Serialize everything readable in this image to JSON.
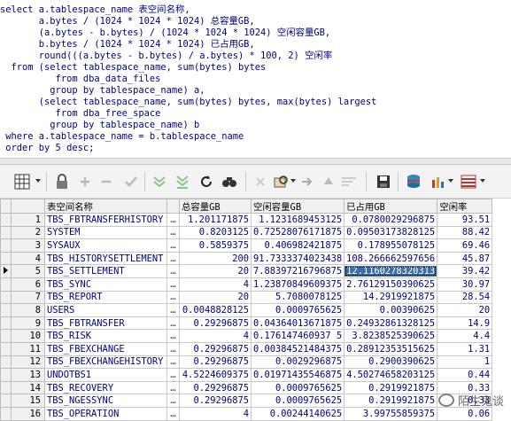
{
  "sql": {
    "lines": [
      {
        "text": "select a.tablespace_name 表空间名称,"
      },
      {
        "text": "       a.bytes / (1024 * 1024 * 1024) 总容量GB,"
      },
      {
        "text": "       (a.bytes - b.bytes) / (1024 * 1024 * 1024) 空闲容量GB,"
      },
      {
        "text": "       b.bytes / (1024 * 1024 * 1024) 已占用GB,"
      },
      {
        "text": "       round(((a.bytes - b.bytes) / a.bytes) * 100, 2) 空闲率"
      },
      {
        "text": "  from (select tablespace_name, sum(bytes) bytes"
      },
      {
        "text": "          from dba_data_files"
      },
      {
        "text": "         group by tablespace_name) a,"
      },
      {
        "text": "       (select tablespace_name, sum(bytes) bytes, max(bytes) largest"
      },
      {
        "text": "          from dba_free_space"
      },
      {
        "text": "         group by tablespace_name) b"
      },
      {
        "text": " where a.tablespace_name = b.tablespace_name"
      },
      {
        "text": " order by 5 desc;"
      }
    ]
  },
  "toolbar": {
    "icons": [
      "grid-view-icon",
      "lock-icon",
      "add-row-icon",
      "delete-row-icon",
      "post-edit-icon",
      "fetch-next-icon",
      "fetch-last-icon",
      "refresh-icon",
      "find-icon",
      "clear-icon",
      "query-by-example-icon",
      "export-icon",
      "sort-up-icon",
      "sort-down-icon",
      "chart-icon",
      "save-icon",
      "print-icon",
      "single-record-icon",
      "table-options-icon"
    ]
  },
  "grid": {
    "columns": [
      "表空间名称",
      "总容量GB",
      "空闲容量GB",
      "已占用GB",
      "空闲率"
    ],
    "rows": [
      {
        "n": "1",
        "name": "TBS_FBTRANSFERHISTORY",
        "total": "1.201171875",
        "free": "1.1231689453125",
        "used": "0.0780029296875",
        "rate": "93.51"
      },
      {
        "n": "2",
        "name": "SYSTEM",
        "total": "0.8203125",
        "free": "0.72528076171875",
        "used": "0.09503173828125",
        "rate": "88.42"
      },
      {
        "n": "3",
        "name": "SYSAUX",
        "total": "0.5859375",
        "free": "0.406982421875",
        "used": "0.178955078125",
        "rate": "69.46"
      },
      {
        "n": "4",
        "name": "TBS_HISTORYSETTLEMENT",
        "total": "200",
        "free": "91.7333374023438",
        "used": "108.266662597656",
        "rate": "45.87"
      },
      {
        "n": "5",
        "name": "TBS_SETTLEMENT",
        "total": "20",
        "free": "7.88397216796875",
        "used": "12.1160278320313",
        "rate": "39.42"
      },
      {
        "n": "6",
        "name": "TBS_SYNC",
        "total": "4",
        "free": "1.23870849609375",
        "used": "2.76129150390625",
        "rate": "30.97"
      },
      {
        "n": "7",
        "name": "TBS_REPORT",
        "total": "20",
        "free": "5.7080078125",
        "used": "14.2919921875",
        "rate": "28.54"
      },
      {
        "n": "8",
        "name": "USERS",
        "total": "0.0048828125",
        "free": "0.0009765625",
        "used": "0.00390625",
        "rate": "20"
      },
      {
        "n": "9",
        "name": "TBS_FBTRANSFER",
        "total": "0.29296875",
        "free": "0.04364013671875",
        "used": "0.24932861328125",
        "rate": "14.9"
      },
      {
        "n": "10",
        "name": "TBS_RISK",
        "total": "4",
        "free": "0.176147460937 5",
        "used": "3.8238525390625",
        "rate": "4.4"
      },
      {
        "n": "11",
        "name": "TBS_FBEXCHANGE",
        "total": "0.29296875",
        "free": "0.00384521484375",
        "used": "0.28912353515625",
        "rate": "1.31"
      },
      {
        "n": "12",
        "name": "TBS_FBEXCHANGEHISTORY",
        "total": "0.29296875",
        "free": "0.0029296875",
        "used": "0.2900390625",
        "rate": "1"
      },
      {
        "n": "13",
        "name": "UNDOTBS1",
        "total": "4.5224609375",
        "free": "0.01971435546875",
        "used": "4.50274658203125",
        "rate": "0.44"
      },
      {
        "n": "14",
        "name": "TBS_RECOVERY",
        "total": "0.29296875",
        "free": "0.0009765625",
        "used": "0.2919921875",
        "rate": "0.33"
      },
      {
        "n": "15",
        "name": "TBS_NGESSYNC",
        "total": "0.29296875",
        "free": "0.0009765625",
        "used": "0.2919921875",
        "rate": "0.33"
      },
      {
        "n": "16",
        "name": "TBS_OPERATION",
        "total": "4",
        "free": "0.00244140625",
        "used": "3.99755859375",
        "rate": "0.06"
      }
    ],
    "cell_ellipsis": "…",
    "current_row": "5",
    "highlight_color": "#3a6ea5"
  },
  "watermark": {
    "text": "陌生鬼谈"
  }
}
